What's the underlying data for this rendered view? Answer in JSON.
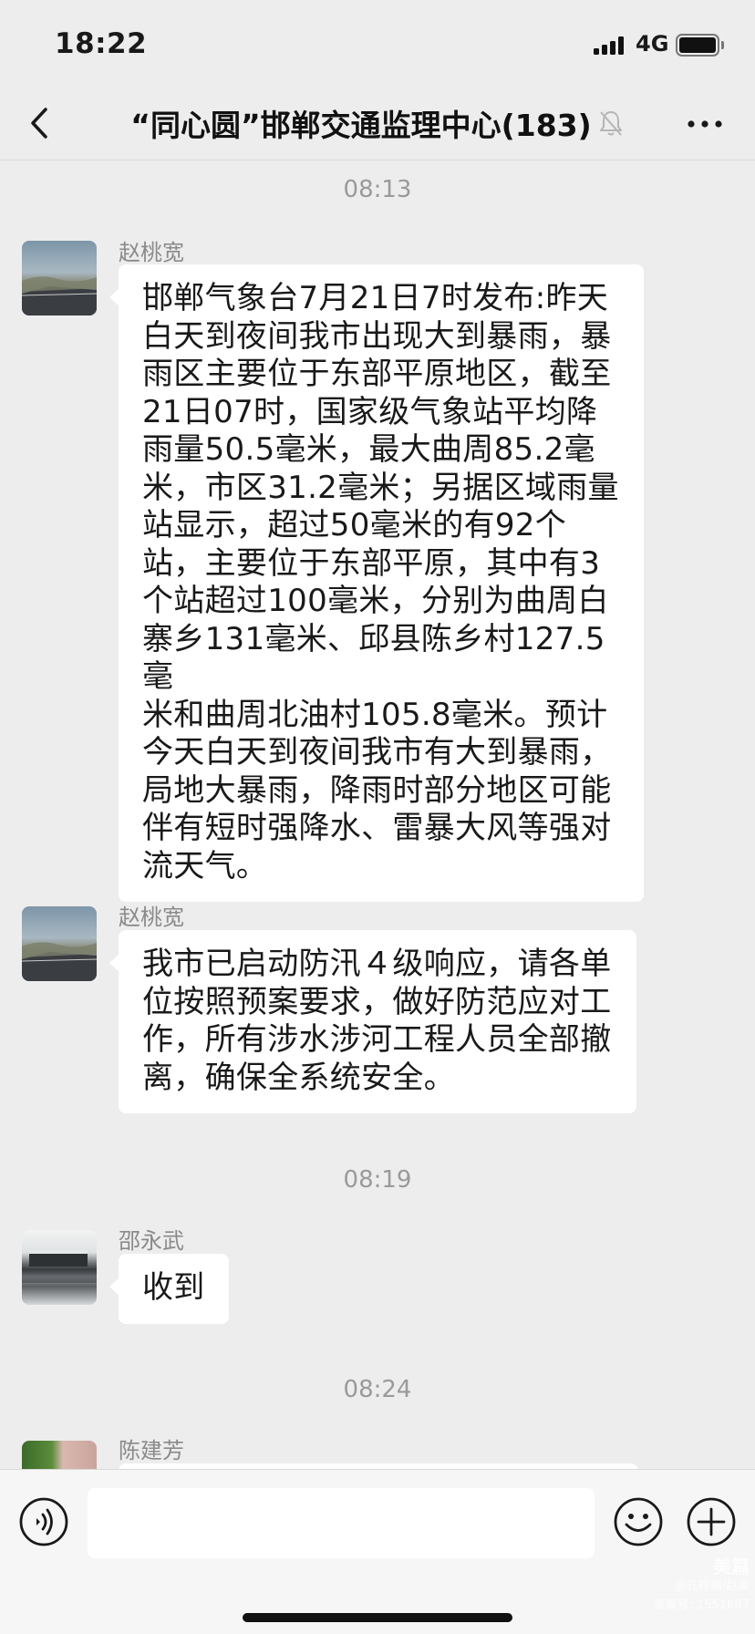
{
  "status_bar": {
    "time": "18:22",
    "network": "4G",
    "icons": [
      "signal-icon",
      "battery-icon"
    ]
  },
  "nav": {
    "title": "“同心圆”邯郸交通监理中心(183)",
    "icons": [
      "back-chevron-icon",
      "mute-bell-icon",
      "more-dots-icon"
    ]
  },
  "chat": {
    "time_1": "08:13",
    "msg_1": {
      "sender": "赵桃宽",
      "lines": [
        "邯郸气象台7月21日7时发布:昨天",
        "白天到夜间我市出现大到暴雨，暴",
        "雨区主要位于东部平原地区，截至",
        "21日07时，国家级气象站平均降",
        "雨量50.5毫米，最大曲周85.2毫",
        "米，市区31.2毫米；另据区域雨量",
        "站显示，超过50毫米的有92个",
        "站，主要位于东部平原，其中有3",
        "个站超过100毫米，分别为曲周白",
        "寨乡131毫米、邱县陈乡村127.5毫",
        "米和曲周北油村105.8毫米。预计",
        "今天白天到夜间我市有大到暴雨，",
        "局地大暴雨，降雨时部分地区可能",
        "伴有短时强降水、雷暴大风等强对",
        "流天气。"
      ]
    },
    "msg_2": {
      "sender": "赵桃宽",
      "lines": [
        "我市已启动防汛４级响应，请各单",
        "位按照预案要求，做好防范应对工",
        "作，所有涉水涉河工程人员全部撤",
        "离，确保全系统安全。"
      ]
    },
    "time_2": "08:19",
    "msg_3": {
      "sender": "邵永武",
      "text": "收到"
    },
    "time_3": "08:24",
    "msg_4": {
      "sender": "陈建芳"
    }
  },
  "input_bar": {
    "icons": [
      "voice-icon",
      "emoji-icon",
      "plus-icon"
    ]
  },
  "watermark": {
    "brand": "美篇",
    "line_1": "@孔祥瑞/赵美",
    "line_2": "美篇号: 1551687"
  },
  "colors": {
    "background": "#EDEDED",
    "bubble": "#FFFFFF",
    "muted_text": "#9A9A9A",
    "text": "#191919"
  }
}
